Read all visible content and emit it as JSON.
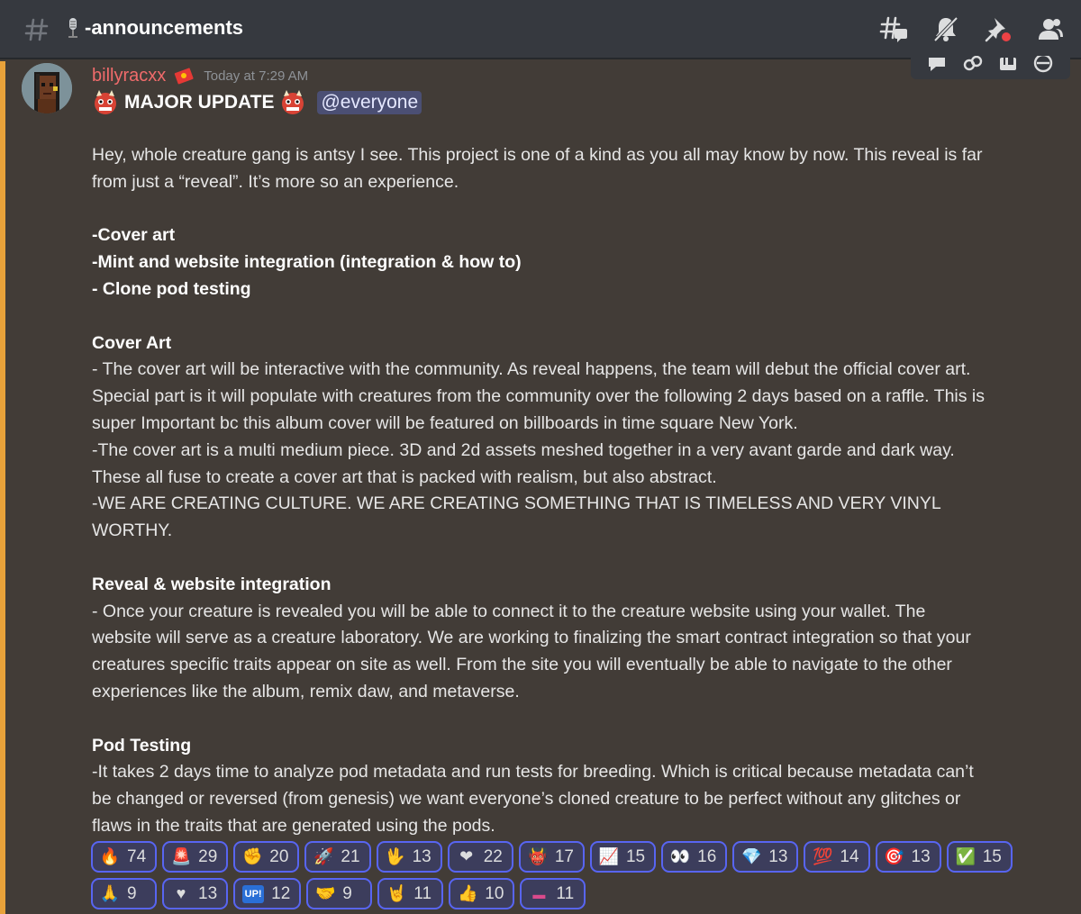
{
  "header": {
    "channel_name": "-announcements",
    "icons": [
      "threads-icon",
      "mute-icon",
      "pin-icon",
      "members-icon"
    ]
  },
  "message": {
    "username": "billyracxx",
    "timestamp": "Today at 7:29 AM",
    "title": "MAJOR UPDATE",
    "mention": "@everyone",
    "lines": [
      {
        "text": "Hey, whole creature gang is antsy I see. This project is one of a kind as you all may know by now. This reveal is far",
        "bold": false
      },
      {
        "text": "from just a “reveal”. It’s more so an experience.",
        "bold": false
      },
      {
        "text": "",
        "bold": false
      },
      {
        "text": "-Cover art",
        "bold": true
      },
      {
        "text": "-Mint and website integration (integration & how to)",
        "bold": true
      },
      {
        "text": "- Clone pod testing",
        "bold": true
      },
      {
        "text": "",
        "bold": false
      },
      {
        "text": "Cover Art",
        "bold": true
      },
      {
        "text": "- The cover art will be interactive with the community. As reveal happens, the team will debut the official cover art.",
        "bold": false
      },
      {
        "text": "Special part is it will populate with creatures from the community over the following 2 days based on a raffle. This is",
        "bold": false
      },
      {
        "text": "super Important bc this album cover will be featured on billboards in time square New York.",
        "bold": false
      },
      {
        "text": "-The cover art is a multi medium piece. 3D and 2d assets meshed together in a very avant garde and dark way.",
        "bold": false
      },
      {
        "text": "These all fuse to create a cover art  that is packed with  realism, but also abstract.",
        "bold": false
      },
      {
        "text": "-WE ARE CREATING CULTURE. WE ARE CREATING SOMETHING THAT IS TIMELESS AND VERY VINYL",
        "bold": false
      },
      {
        "text": "WORTHY.",
        "bold": false
      },
      {
        "text": "",
        "bold": false
      },
      {
        "text": "Reveal & website integration",
        "bold": true
      },
      {
        "text": "- Once your creature is revealed you will be able to connect it to the creature website using your wallet. The",
        "bold": false
      },
      {
        "text": "website will serve as a creature laboratory. We are working to finalizing the smart contract integration so that your",
        "bold": false
      },
      {
        "text": "creatures specific traits appear on site as well. From the site you will eventually be able to navigate to the other",
        "bold": false
      },
      {
        "text": "experiences like the album, remix daw, and metaverse.",
        "bold": false
      },
      {
        "text": "",
        "bold": false
      },
      {
        "text": "Pod Testing",
        "bold": true
      },
      {
        "text": "-It takes 2 days time to analyze pod metadata and run tests for breeding. Which is critical because metadata can’t",
        "bold": false
      },
      {
        "text": "be changed or reversed (from genesis) we want everyone’s cloned creature to be perfect without any glitches or",
        "bold": false
      },
      {
        "text": "flaws in the traits that are generated using the pods.",
        "bold": false
      }
    ]
  },
  "reactions": [
    {
      "emoji": "🔥",
      "icon": "fire-icon",
      "count": "74"
    },
    {
      "emoji": "🚨",
      "icon": "siren-icon",
      "count": "29"
    },
    {
      "emoji": "✊",
      "icon": "fist-icon",
      "count": "20"
    },
    {
      "emoji": "🚀",
      "icon": "rocket-icon",
      "count": "21"
    },
    {
      "emoji": "🖖",
      "icon": "vulcan-salute-icon",
      "count": "13"
    },
    {
      "emoji": "❤",
      "icon": "heart-icon",
      "count": "22"
    },
    {
      "emoji": "👹",
      "icon": "oni-icon",
      "count": "17"
    },
    {
      "emoji": "📈",
      "icon": "chart-increasing-icon",
      "count": "15"
    },
    {
      "emoji": "👀",
      "icon": "eyes-icon",
      "count": "16"
    },
    {
      "emoji": "💎",
      "icon": "gem-icon",
      "count": "13"
    },
    {
      "emoji": "💯",
      "icon": "hundred-icon",
      "count": "14"
    },
    {
      "emoji": "🎯",
      "icon": "target-icon",
      "count": "13"
    },
    {
      "emoji": "✅",
      "icon": "check-mark-icon",
      "count": "15"
    },
    {
      "emoji": "🙏",
      "icon": "folded-hands-icon",
      "count": "9"
    },
    {
      "emoji": "♥",
      "icon": "heart-suit-icon",
      "count": "13"
    },
    {
      "emoji": "UP!",
      "icon": "up-button-icon",
      "count": "12"
    },
    {
      "emoji": "🤝",
      "icon": "handshake-icon",
      "count": "9"
    },
    {
      "emoji": "🤘",
      "icon": "rock-on-icon",
      "count": "11"
    },
    {
      "emoji": "👍",
      "icon": "thumbs-up-icon",
      "count": "10"
    },
    {
      "emoji": "▬",
      "icon": "custom-sticker-icon",
      "count": "11"
    }
  ],
  "colors": {
    "background": "#423c37",
    "header": "#36393f",
    "highlight": "#e8a23a",
    "username": "#f06b6b",
    "reaction_border": "#5865f2",
    "mention_bg": "#4b4f74"
  }
}
